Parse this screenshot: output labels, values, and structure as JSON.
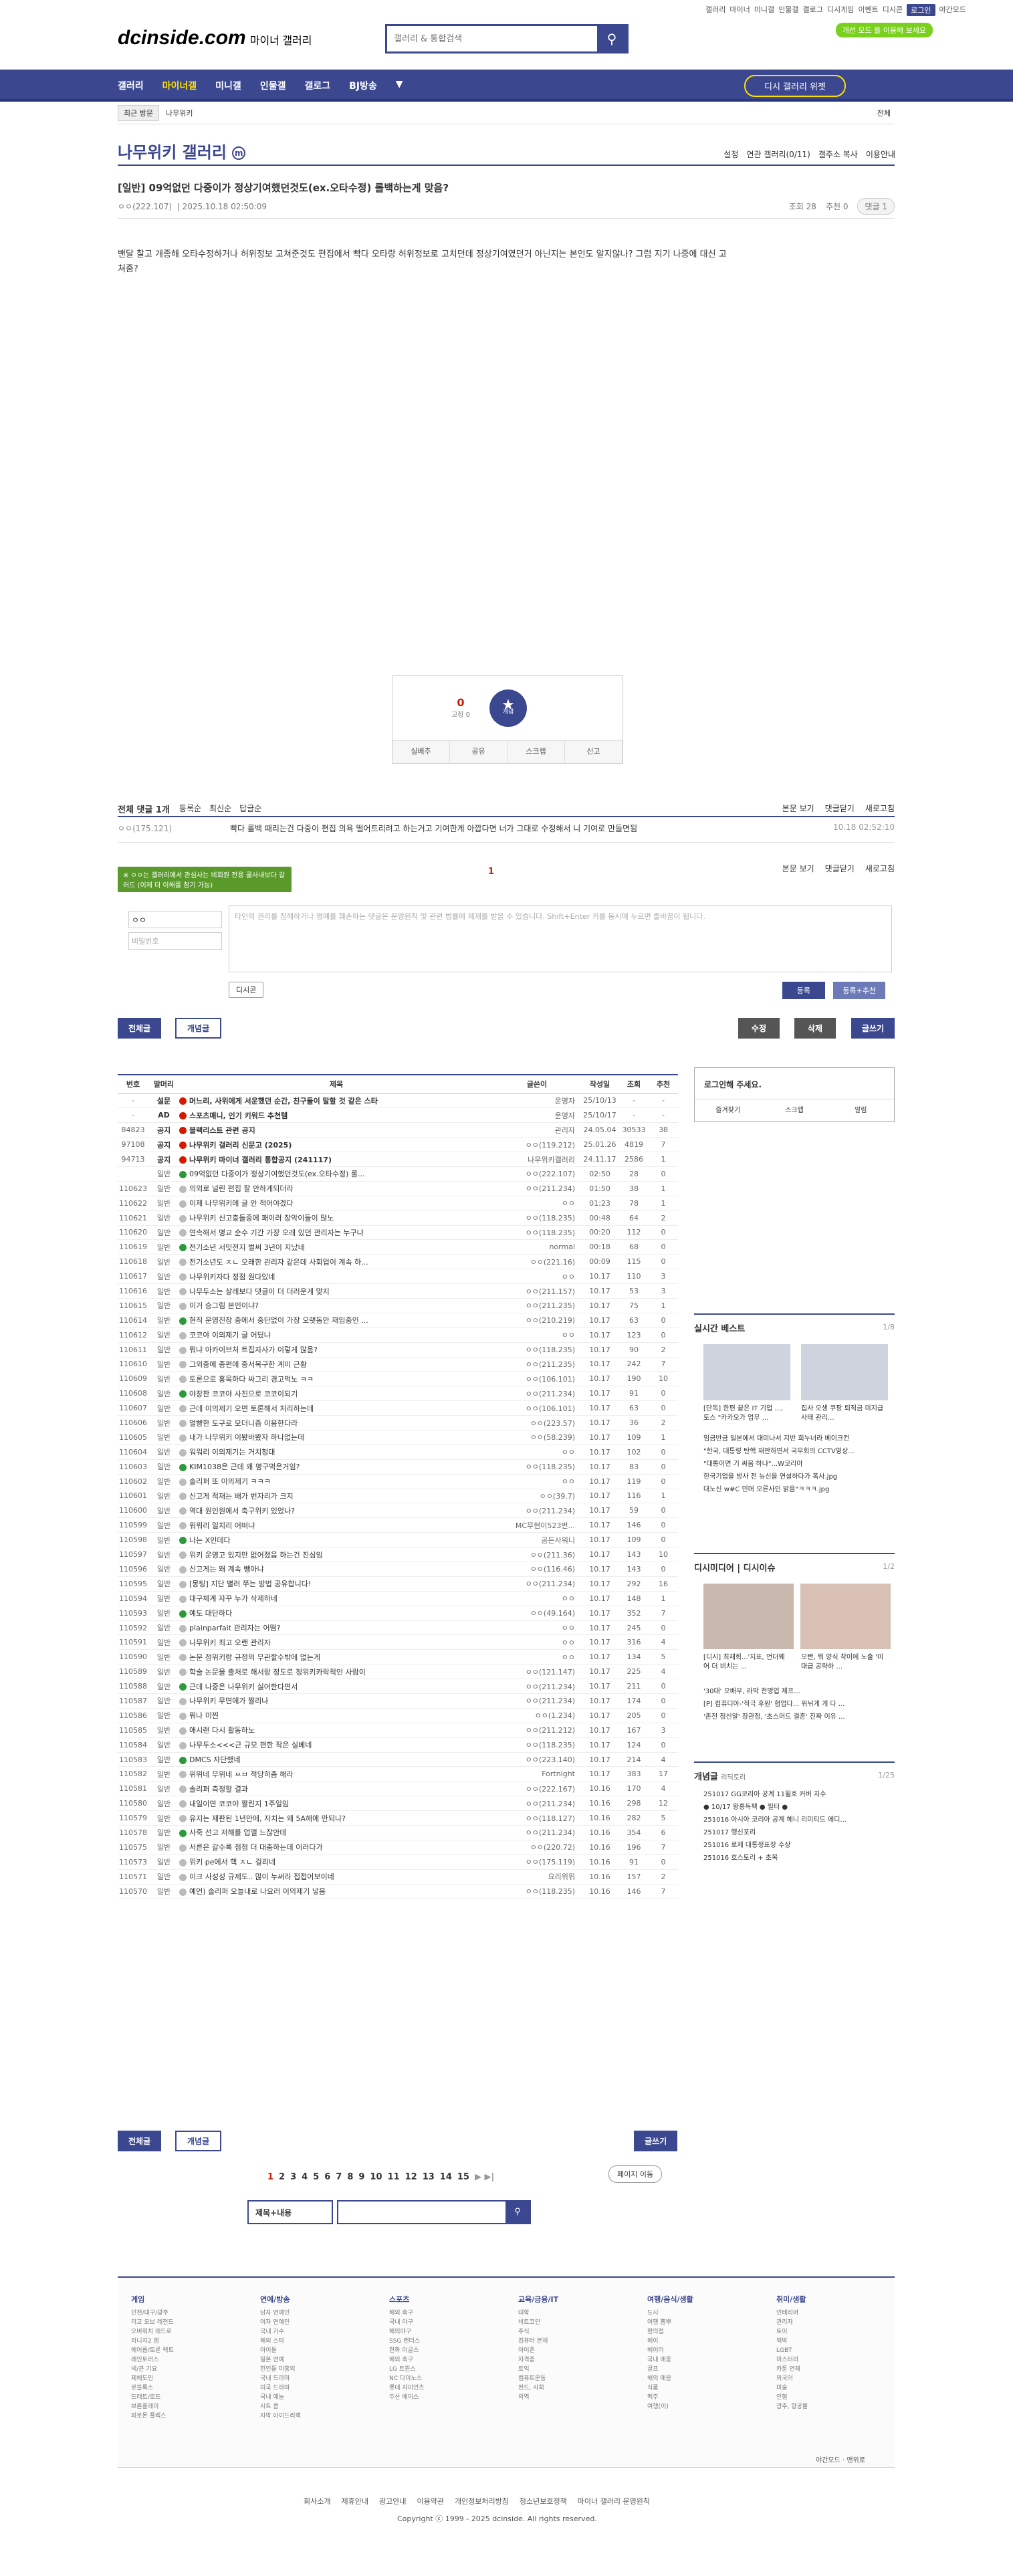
{
  "top_links": [
    "갤러리",
    "마이너",
    "미니갤",
    "인물갤",
    "갤로그",
    "디시게임",
    "이벤트",
    "디시콘",
    "로그인",
    "야간모드"
  ],
  "logo": {
    "main": "dcinside.com",
    "sub": "마이너 갤러리"
  },
  "search": {
    "placeholder": "갤러리 & 통합검색"
  },
  "dark_mode": "개선 모드 를 이용해 보세요",
  "gnb": {
    "items": [
      "갤러리",
      "마이너갤",
      "미니갤",
      "인물갤",
      "갤로그",
      "BJ방송"
    ],
    "widget": "디시 갤러리 위젯"
  },
  "lnb": {
    "recent": "최근 방문",
    "item": "나무위키",
    "close": "전체"
  },
  "gallery": {
    "title": "나무위키 갤러리",
    "tools": [
      "설정",
      "연관 갤러리(0/11)",
      "갤주소 복사",
      "이용안내"
    ]
  },
  "post": {
    "title": "[일반] 09억없던 다중이가 정상기여했던것도(ex.오타수정) 롤백하는게 맞음?",
    "author": "ㅇㅇ(222.107)",
    "date": "2025.10.18 02:50:09",
    "views": "조회 28",
    "recommend": "추천 0",
    "comments": "댓글 1",
    "body": "밴달 찰고 개종해 오타수정하거나 허위정보 고쳐준것도 편집에서 빡다 오타랑 허위정보로 고치던데 정상기여였던거 아닌지는 본인도 알지않나? 그럼 지기 나중에 대신 고쳐줌?"
  },
  "recommend": {
    "up": "0",
    "up_sub": "고정 0",
    "star": "★",
    "star_label": "개념",
    "bar": [
      "실베추",
      "공유",
      "스크랩",
      "신고"
    ]
  },
  "comments": {
    "count_label": "전체 댓글 1개",
    "sort": [
      "등록순",
      "최신순",
      "답글순"
    ],
    "right": [
      "본문 보기",
      "댓글닫기",
      "새로고침"
    ],
    "rows": [
      {
        "nick": "ㅇㅇ(175.121)",
        "text": "빡다 롤백 때리는건 다중이 편집 의욕 떨어트리려고 하는거고 기여한게 아깝다면 너가 그대로 수정해서 니 기여로 만들면됨",
        "date": "10.18 02:52:10"
      }
    ],
    "page": "1",
    "tip": "※ ㅇㅇ는 갤러리에서 관심사는 비회원 전용 콜사내보다 갈러드 (이제 더 이해를 참기 가능)",
    "nick_value": "ㅇㅇ",
    "pw_placeholder": "비밀번호",
    "text_placeholder": "타인의 권리를 침해하거나 명예를 훼손하는 댓글은 운영원칙 및 관련 법률에 제재를 받을 수 있습니다. Shift+Enter 키를 동시에 누르면 줄바꿈이 됩니다.",
    "dccon": "디시콘",
    "submit": "등록",
    "submit2": "등록+추천"
  },
  "buttons": {
    "all": "전체글",
    "concept": "개념글",
    "edit": "수정",
    "delete": "삭제",
    "write": "글쓰기"
  },
  "list": {
    "headers": [
      "번호",
      "말머리",
      "제목",
      "글쓴이",
      "작성일",
      "조회",
      "추천"
    ],
    "rows": [
      [
        "-",
        "설문",
        "머느리, 사위에게 서운했던 순간, 친구들이 말할 것 같은 스타",
        "운영자",
        "25/10/13",
        "-",
        "-"
      ],
      [
        "-",
        "AD",
        "스포츠매니, 인기 키워드 추천템",
        "운영자",
        "25/10/17",
        "-",
        "-"
      ],
      [
        "84823",
        "공지",
        "블랙리스트 관련 공지",
        "관리자",
        "24.05.04",
        "30533",
        "38"
      ],
      [
        "97108",
        "공지",
        "나무위키 갤러리 신문고 (2025)",
        "ㅇㅇ(119.212)",
        "25.01.26",
        "4819",
        "7"
      ],
      [
        "94713",
        "공지",
        "나무위키 마이너 갤러리 통합공지 (241117)",
        "나무위키갤러리",
        "24.11.17",
        "2586",
        "1"
      ],
      [
        "",
        "일반",
        "09억없던 다중이가 정상기여했던것도(ex.오타수정) 롤...",
        "ㅇㅇ(222.107)",
        "02:50",
        "28",
        "0"
      ],
      [
        "110623",
        "일반",
        "의외로 널린 편집 잘 안하게되더라",
        "ㅇㅇ(211.234)",
        "01:50",
        "38",
        "1"
      ],
      [
        "110622",
        "일반",
        "이제 나무위키에 글 안 적어야겠다",
        "ㅇㅇ",
        "01:23",
        "78",
        "1"
      ],
      [
        "110621",
        "일반",
        "나무위키 신고충들중에 패이러 장악이들이 많노",
        "ㅇㅇ(118.235)",
        "00:48",
        "64",
        "2"
      ],
      [
        "110620",
        "일반",
        "연속해서 명교 순수 기간 가장 오래 있던 관리자는 누구냐",
        "ㅇㅇ(118.235)",
        "00:20",
        "112",
        "0"
      ],
      [
        "110619",
        "일반",
        "전기소년 서밋전지 벌써 3년이 지났네",
        "normal",
        "00:18",
        "68",
        "0"
      ],
      [
        "110618",
        "일반",
        "전기소년도 ㅈㄴ 오래한 관리자 같은데 사회업이 계속 하...",
        "ㅇㅇ(221.16)",
        "00:09",
        "115",
        "0"
      ],
      [
        "110617",
        "일반",
        "나무위키자다 정점 원다있네",
        "ㅇㅇ",
        "10.17",
        "110",
        "3"
      ],
      [
        "110616",
        "일반",
        "나무두소는 살레보다 댓글이 더 더러운게 맞지",
        "ㅇㅇ(211.157)",
        "10.17",
        "53",
        "3"
      ],
      [
        "110615",
        "일반",
        "이거 승그림 본인이냐?",
        "ㅇㅇ(211.235)",
        "10.17",
        "75",
        "1"
      ],
      [
        "110614",
        "일반",
        "현직 운영진장 중에서 중단없이 가장 오랫동안 재임중인 ...",
        "ㅇㅇ(210.219)",
        "10.17",
        "63",
        "0"
      ],
      [
        "110612",
        "일반",
        "코코야 이의제기 글 어딨냐",
        "ㅇㅇ",
        "10.17",
        "123",
        "0"
      ],
      [
        "110611",
        "일반",
        "뭐냐 아카이브처 트집자사가 이렇게 많음?",
        "ㅇㅇ(118.235)",
        "10.17",
        "90",
        "2"
      ],
      [
        "110610",
        "일반",
        "그외중에 종편에 중서목구한 계이 근황",
        "ㅇㅇ(211.235)",
        "10.17",
        "242",
        "7"
      ],
      [
        "110609",
        "일반",
        "토론으로 홍목하다 싸그리 경고먹노 ㅋㅋ",
        "ㅇㅇ(106.101)",
        "10.17",
        "190",
        "10"
      ],
      [
        "110608",
        "일반",
        "야장판 코코야 사진으로 코코이되기",
        "ㅇㅇ(211.234)",
        "10.17",
        "91",
        "0"
      ],
      [
        "110607",
        "일반",
        "근데 이의제기 오면 토론해서 처리하는데",
        "ㅇㅇ(106.101)",
        "10.17",
        "63",
        "0"
      ],
      [
        "110606",
        "일반",
        "얼빵한 도구로 모더니즘 이용한다라",
        "ㅇㅇ(223.57)",
        "10.17",
        "36",
        "2"
      ],
      [
        "110605",
        "일반",
        "내가 나무위키 이봤바봤자 하나없는데",
        "ㅇㅇ(58.239)",
        "10.17",
        "109",
        "1"
      ],
      [
        "110604",
        "일반",
        "워워리 이의제기는 거치청대",
        "ㅇㅇ",
        "10.17",
        "102",
        "0"
      ],
      [
        "110603",
        "일반",
        "KIM1038은 근데 왜 명구먹은거임?",
        "ㅇㅇ(118.235)",
        "10.17",
        "83",
        "0"
      ],
      [
        "110602",
        "일반",
        "솔리퍼 또 이의제기 ㅋㅋㅋ",
        "ㅇㅇ",
        "10.17",
        "119",
        "0"
      ],
      [
        "110601",
        "일반",
        "신고게 적재는 배가 번자리가 크지",
        "ㅇㅇ(39.7)",
        "10.17",
        "116",
        "1"
      ],
      [
        "110600",
        "일반",
        "역대 원인원에서 축구위키 있었나?",
        "ㅇㅇ(211.234)",
        "10.17",
        "59",
        "0"
      ],
      [
        "110599",
        "일반",
        "워워리 일치리 어떠냐",
        "MC무현이523번...",
        "10.17",
        "146",
        "0"
      ],
      [
        "110598",
        "일반",
        "나는 X인데다",
        "공든사워니",
        "10.17",
        "109",
        "0"
      ],
      [
        "110597",
        "일반",
        "위키 운영고 있지만 없어졌음 하는건 진심임",
        "ㅇㅇ(211.36)",
        "10.17",
        "143",
        "10"
      ],
      [
        "110596",
        "일반",
        "신고게는 왜 계속 뺑아냐",
        "ㅇㅇ(116.46)",
        "10.17",
        "143",
        "0"
      ],
      [
        "110595",
        "일반",
        "[몽팅] 지단 별러 쭈는 방법 공유합니다!",
        "ㅇㅇ(211.234)",
        "10.17",
        "292",
        "16"
      ],
      [
        "110594",
        "일반",
        "대구체계 자꾸 누가 삭제하네",
        "ㅇㅇ",
        "10.17",
        "148",
        "1"
      ],
      [
        "110593",
        "일반",
        "예도 대단하다",
        "ㅇㅇ(49.164)",
        "10.17",
        "352",
        "7"
      ],
      [
        "110592",
        "일반",
        "plainparfait 관리자는 어떰?",
        "ㅇㅇ",
        "10.17",
        "245",
        "0"
      ],
      [
        "110591",
        "일반",
        "나무위키 최고 오랜 관리자",
        "ㅇㅇ",
        "10.17",
        "316",
        "4"
      ],
      [
        "110590",
        "일반",
        "논문 정위키랑 규정의 무관할수밖에 없는게",
        "ㅇㅇ",
        "10.17",
        "134",
        "5"
      ],
      [
        "110589",
        "일반",
        "학술 논문을 출처로 해서랑 정도로 정위키카락적인 사람이",
        "ㅇㅇ(121.147)",
        "10.17",
        "225",
        "4"
      ],
      [
        "110588",
        "일반",
        "근데 나중은 나무위키 싫어한다면서",
        "ㅇㅇ(211.234)",
        "10.17",
        "211",
        "0"
      ],
      [
        "110587",
        "일반",
        "나무위키 무면에가 짤리나",
        "ㅇㅇ(211.234)",
        "10.17",
        "174",
        "0"
      ],
      [
        "110586",
        "일반",
        "뭐나 미찐",
        "ㅇㅇ(1.234)",
        "10.17",
        "205",
        "0"
      ],
      [
        "110585",
        "일반",
        "애시랜 다시 활동하노",
        "ㅇㅇ(211.212)",
        "10.17",
        "167",
        "3"
      ],
      [
        "110584",
        "일반",
        "나무두소<<<근 규모 편한 작은 실베네",
        "ㅇㅇ(118.235)",
        "10.17",
        "124",
        "0"
      ],
      [
        "110583",
        "일반",
        "DMCS 자단했네",
        "ㅇㅇ(223.140)",
        "10.17",
        "214",
        "4"
      ],
      [
        "110582",
        "일반",
        "위위네 무위네 ㅆㅂ 적당히좀 해라",
        "Fortnight",
        "10.17",
        "383",
        "17"
      ],
      [
        "110581",
        "일반",
        "솔리퍼 측정할 결과",
        "ㅇㅇ(222.167)",
        "10.16",
        "170",
        "4"
      ],
      [
        "110580",
        "일반",
        "내일이면 코코야 짤린지 1주일임",
        "ㅇㅇ(211.234)",
        "10.16",
        "298",
        "12"
      ],
      [
        "110579",
        "일반",
        "유지는 재판된 1년만에, 자치는 왜 5A해에 만되나?",
        "ㅇㅇ(118.127)",
        "10.16",
        "282",
        "5"
      ],
      [
        "110578",
        "일반",
        "사죽 선고 저해를 업엘 느잖안데",
        "ㅇㅇ(211.234)",
        "10.16",
        "354",
        "6"
      ],
      [
        "110575",
        "일반",
        "서른은 갈수록 점점 더 대충하는데 이러다가",
        "ㅇㅇ(220.72)",
        "10.16",
        "196",
        "7"
      ],
      [
        "110573",
        "일반",
        "위키 pe에서 핵 ㅈㄴ 걸리네",
        "ㅇㅇ(175.119)",
        "10.16",
        "91",
        "0"
      ],
      [
        "110571",
        "일반",
        "이크 사성성 규제도.. 많이 누써라 접접어보이네",
        "요리위위",
        "10.16",
        "157",
        "2"
      ],
      [
        "110570",
        "일반",
        "예언) 솔리퍼 오늘내로 나요러 이의제기 넣음",
        "ㅇㅇ(118.235)",
        "10.16",
        "146",
        "7"
      ]
    ]
  },
  "sidebar": {
    "login": {
      "title": "로그인해 주세요.",
      "btns": [
        "즐겨찾기",
        "스크랩",
        "알림"
      ]
    },
    "best": {
      "title": "실시간 베스트",
      "page": "1/8",
      "caps": [
        "[단독] 한편 끝은 IT 기업 ..., 토스 \"카카오가 업무 ...",
        "집사 오생 쿠팡 퇴직금 미지급 사태 관리..."
      ],
      "items": [
        "임금반금 일본에서 대미나서 지반 회누너라 베이크컨",
        "\"한국, 대통령 탄핵 재판하면서 국무회의 CCTV영상...",
        "\"대통이면 기 싸움 하냐\"...W코리아",
        "한국기업을 방사 전 뉴신을 연설하다가 폭사.jpg",
        "대노신 w#C 민머 오른사인 밝음\"ㅋㅋㅋ.jpg"
      ]
    },
    "issue": {
      "title": "디시미디어",
      "tab2": "디시이슈",
      "page": "1/2",
      "caps": [
        "[디시] 최재희...'지표, 언더웨어 더 비치는 ...",
        "오빤, 뭐 양식 착이에 노출 '미대급 공략하 ..."
      ],
      "items": [
        "'30대' 오배우, 라막 천명업 제프...",
        "[P] 컴퓨디아-'적극 후원' 협업다... 위뉘게 게 다 ...",
        "'존전 정신알' 장관정, '초스머드 결혼' 진짜 이유 ..."
      ]
    },
    "concept": {
      "title": "개념글",
      "sub": "리딕토리",
      "page": "1/25",
      "items": [
        "251017 GG코리아 공계 11월호 커버 지수",
        "● 10/17 왕홍독팩 ● 필터 ●",
        "251016 아시아 코리아 공계 헤니 리미티드 에디...",
        "251017 행신포리",
        "251016 로제 대통정표장 수상",
        "251016 호스토리 + 초복"
      ]
    }
  },
  "pagination": {
    "pages": [
      "1",
      "2",
      "3",
      "4",
      "5",
      "6",
      "7",
      "8",
      "9",
      "10",
      "11",
      "12",
      "13",
      "14",
      "15"
    ],
    "jump": "페이지 이동"
  },
  "list_search": {
    "select": "제목+내용"
  },
  "footer": {
    "cols": [
      {
        "h": "게임",
        "items": [
          "인천/대구/광주",
          "리고 오브 레전드",
          "오버워치 레드로",
          "리니지2 엠",
          "헤어롭/토론 렉트",
          "레인토러스",
          "넥/큰 기요",
          "제헤도민",
          "로블록스",
          "드래트/로드",
          "브론플레이",
          "피로몬 플렉스"
        ]
      },
      {
        "h": "연예/방송",
        "items": [
          "남자 연예인",
          "여자 연예인",
          "국내 가수",
          "해외 스타",
          "아이돌",
          "일본 연예",
          "힌인들 미홍의",
          "국내 드라마",
          "미국 드라마",
          "국내 예능",
          "시트 콤",
          "자막 아이드리팩"
        ]
      },
      {
        "h": "스포츠",
        "items": [
          "해외 축구",
          "국내 야구",
          "해외야구",
          "SSG 랜더스",
          "한화 이글스",
          "해외 축구",
          "LG 트윈스",
          "NC 다이노스",
          "롯데 자이언츠",
          "두산 베이스"
        ]
      },
      {
        "h": "교육/금융/IT",
        "items": [
          "대학",
          "비트코인",
          "주식",
          "컴퓨터 본체",
          "아이폰",
          "자격증",
          "토익",
          "컴퓨트운동",
          "펀드, 사회",
          "의역"
        ]
      },
      {
        "h": "여행/음식/생활",
        "items": [
          "도시",
          "여행 뽐뿌",
          "편의점",
          "헤이",
          "헤어러",
          "국내 애웅",
          "골프",
          "해외 애웅",
          "식품",
          "맥주",
          "여행(이)"
        ]
      },
      {
        "h": "취미/생활",
        "items": [
          "인테리어",
          "관리자",
          "토이",
          "책박",
          "LGBT",
          "미스터리",
          "카툰 연재",
          "외국어",
          "미술",
          "인형",
          "광주, 항공물"
        ]
      }
    ],
    "right": [
      "야간모드",
      "맨위로"
    ],
    "links": [
      "회사소개",
      "제휴안내",
      "광고안내",
      "이용약관",
      "개인정보처리방침",
      "청소년보호정책",
      "마이너 갤러리 운영원칙"
    ],
    "copyright": "Copyright ⓒ 1999 - 2025 dcinside. All rights reserved."
  }
}
